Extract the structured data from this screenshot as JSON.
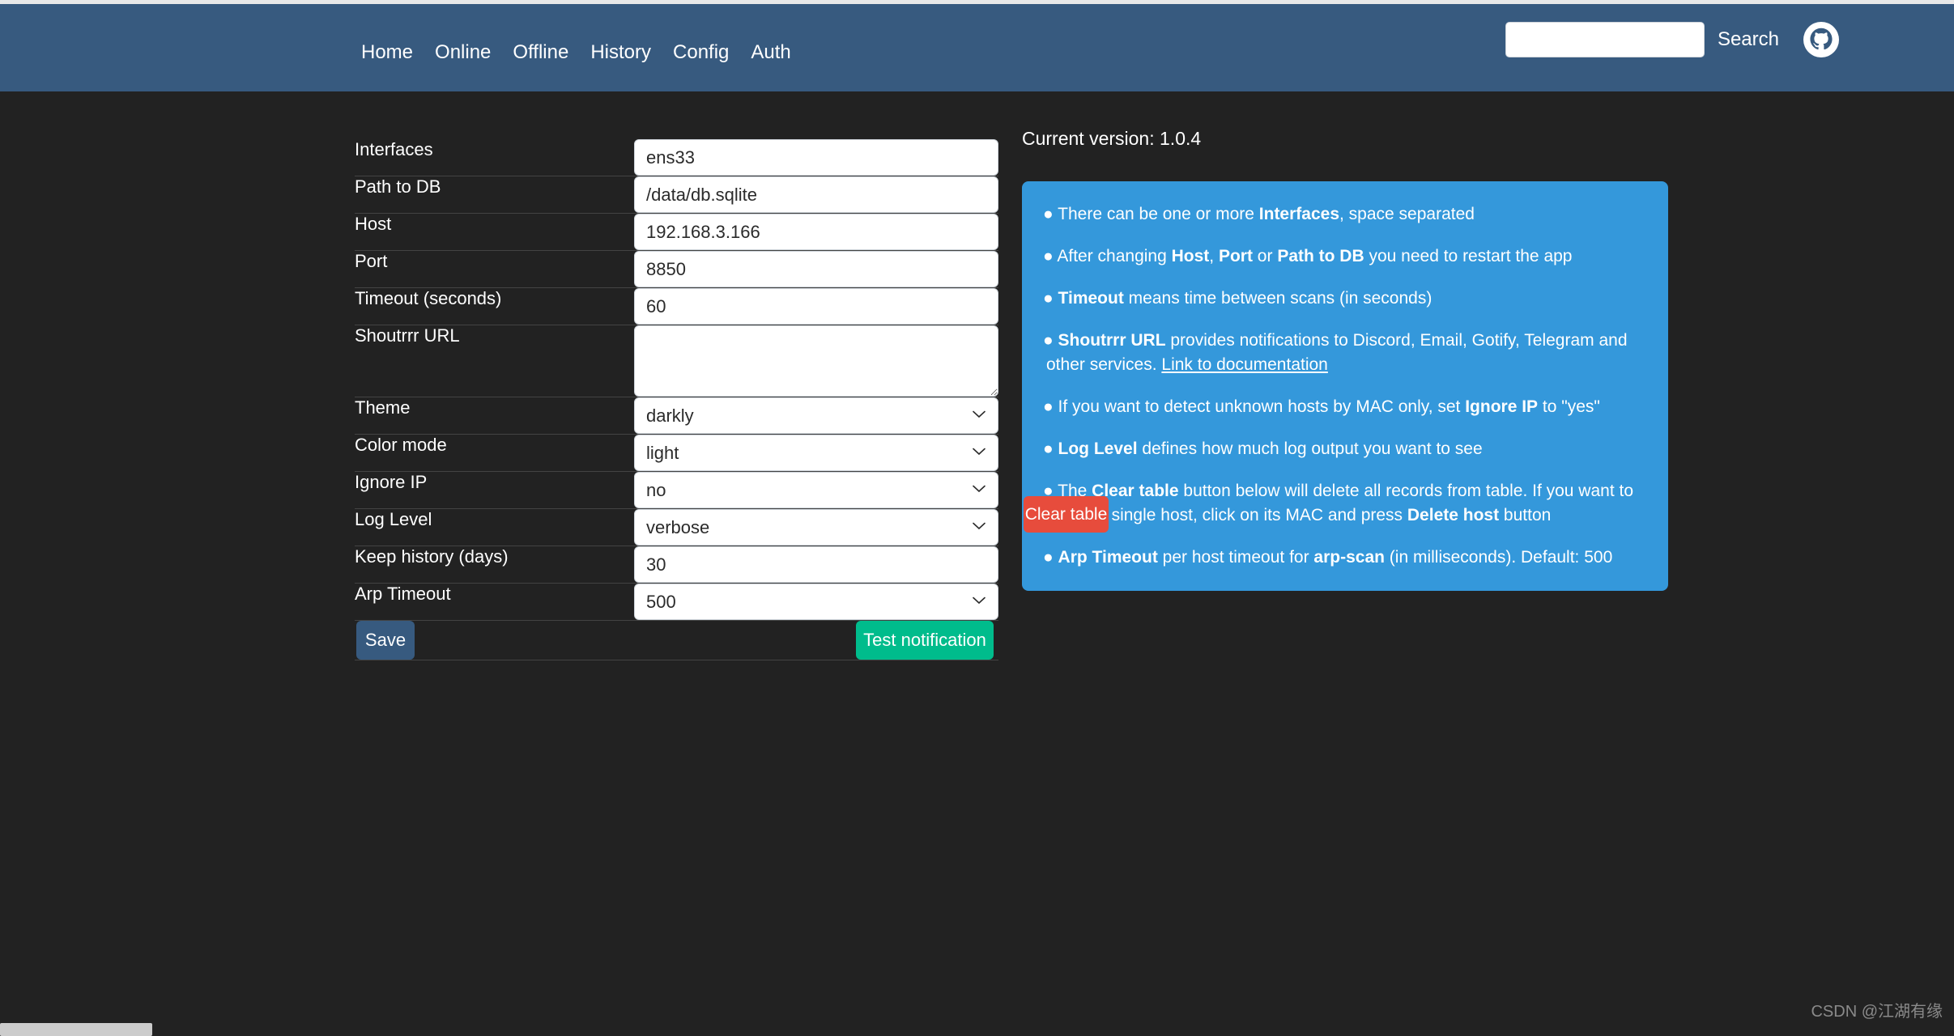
{
  "navbar": {
    "links": [
      {
        "label": "Home"
      },
      {
        "label": "Online"
      },
      {
        "label": "Offline"
      },
      {
        "label": "History"
      },
      {
        "label": "Config"
      },
      {
        "label": "Auth"
      }
    ],
    "search": {
      "value": "",
      "placeholder": "",
      "button_label": "Search"
    },
    "github_icon": "github-icon",
    "background_color": "#375a7f"
  },
  "settings": {
    "rows": [
      {
        "label": "Interfaces",
        "type": "text",
        "value": "ens33"
      },
      {
        "label": "Path to DB",
        "type": "text",
        "value": "/data/db.sqlite"
      },
      {
        "label": "Host",
        "type": "text",
        "value": "192.168.3.166"
      },
      {
        "label": "Port",
        "type": "text",
        "value": "8850"
      },
      {
        "label": "Timeout (seconds)",
        "type": "text",
        "value": "60"
      },
      {
        "label": "Shoutrrr URL",
        "type": "textarea",
        "value": ""
      },
      {
        "label": "Theme",
        "type": "select",
        "value": "darkly"
      },
      {
        "label": "Color mode",
        "type": "select",
        "value": "light"
      },
      {
        "label": "Ignore IP",
        "type": "select",
        "value": "no"
      },
      {
        "label": "Log Level",
        "type": "select",
        "value": "verbose"
      },
      {
        "label": "Keep history (days)",
        "type": "text",
        "value": "30"
      },
      {
        "label": "Arp Timeout",
        "type": "select",
        "value": "500"
      }
    ],
    "save_label": "Save",
    "test_label": "Test notification",
    "save_color": "#375a7f",
    "test_color": "#00bc8c"
  },
  "info": {
    "version_text": "Current version: 1.0.4",
    "panel_color": "#3498db",
    "bullets": [
      {
        "html": "● There can be one or more <b>Interfaces</b>, space separated"
      },
      {
        "html": "● After changing <b>Host</b>, <b>Port</b> or <b>Path to DB</b> you need to restart the app"
      },
      {
        "html": "● <b>Timeout</b> means time between scans (in seconds)"
      },
      {
        "html": "● <b>Shoutrrr URL</b> provides notifications to Discord, Email, Gotify, Telegram and other services. <a class=\"info-link\" data-name=\"documentation-link\" data-interactable=\"true\">Link to documentation</a>"
      },
      {
        "html": "● If you want to detect unknown hosts by MAC only, set <b>Ignore IP</b> to \"yes\""
      },
      {
        "html": "● <b>Log Level</b> defines how much log output you want to see"
      },
      {
        "html": "● The <b>Clear table</b> button below will delete all records from table. If you want to delete a single host, click on its MAC and press <b>Delete host</b> button"
      },
      {
        "html": "● <b>Arp Timeout</b> per host timeout for <b>arp-scan</b> (in milliseconds). Default: 500"
      }
    ],
    "clear_table_label": "Clear table",
    "clear_table_color": "#e74c3c"
  },
  "watermark": {
    "text": "CSDN @江湖有缘"
  }
}
